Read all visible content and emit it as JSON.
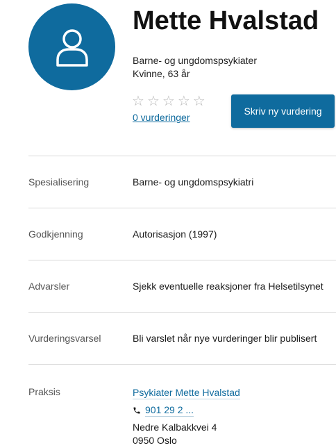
{
  "profile": {
    "name": "Mette Hvalstad",
    "role": "Barne- og ungdomspsykiater",
    "gender_age": "Kvinne, 63 år",
    "avatar_icon": "user-icon"
  },
  "rating": {
    "stars": [
      "☆",
      "☆",
      "☆",
      "☆",
      "☆"
    ],
    "value": 0,
    "max": 5,
    "ratings_link": "0 vurderinger",
    "write_review_button": "Skriv ny vurdering"
  },
  "details": [
    {
      "label": "Spesialisering",
      "value": "Barne- og ungdomspsykiatri"
    },
    {
      "label": "Godkjenning",
      "value": "Autorisasjon (1997)"
    },
    {
      "label": "Advarsler",
      "value": "Sjekk eventuelle reaksjoner fra Helsetilsynet"
    },
    {
      "label": "Vurderingsvarsel",
      "value": "Bli varslet når nye vurderinger blir publisert"
    }
  ],
  "practice": {
    "label": "Praksis",
    "name": "Psykiater Mette Hvalstad",
    "phone": "901 29 2 ...",
    "phone_icon": "phone-icon",
    "address_line1": "Nedre Kalbakkvei 4",
    "address_line2": "0950 Oslo"
  },
  "colors": {
    "accent": "#0f6b9e",
    "star_empty": "#b7b7b7",
    "divider": "#d9d9d9"
  }
}
